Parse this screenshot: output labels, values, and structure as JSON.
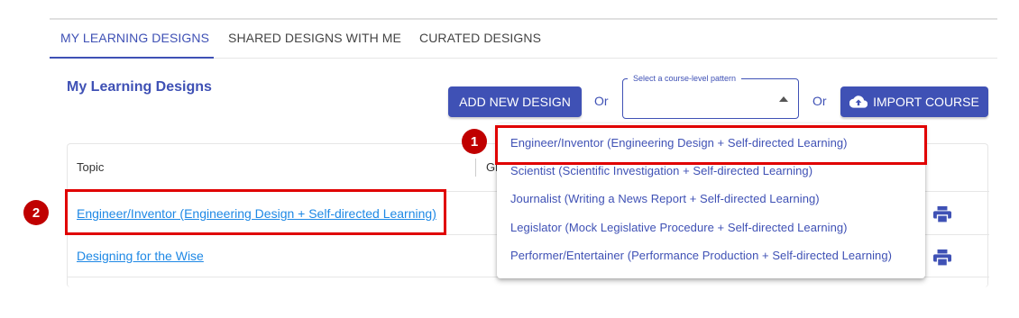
{
  "tabs": [
    {
      "label": "MY LEARNING DESIGNS",
      "active": true
    },
    {
      "label": "SHARED DESIGNS WITH ME",
      "active": false
    },
    {
      "label": "CURATED DESIGNS",
      "active": false
    }
  ],
  "page": {
    "heading": "My Learning Designs"
  },
  "toolbar": {
    "add_label": "ADD NEW DESIGN",
    "or_label": "Or",
    "select_legend": "Select a course-level pattern",
    "select_value": "",
    "import_label": "IMPORT COURSE",
    "import_icon": "cloud-upload-icon"
  },
  "table": {
    "columns": [
      "Topic",
      "Gr"
    ],
    "rows": [
      {
        "topic": "Engineer/Inventor (Engineering Design + Self-directed Learning)",
        "action_icon": "print-icon"
      },
      {
        "topic": "Designing for the Wise",
        "action_icon": "print-icon"
      }
    ]
  },
  "dropdown": {
    "options": [
      "Engineer/Inventor (Engineering Design + Self-directed Learning)",
      "Scientist (Scientific Investigation + Self-directed Learning)",
      "Journalist (Writing a News Report + Self-directed Learning)",
      "Legislator (Mock Legislative Procedure + Self-directed Learning)",
      "Performer/Entertainer (Performance Production + Self-directed Learning)"
    ]
  },
  "annotations": {
    "badge_1": "1",
    "badge_2": "2",
    "highlight_color": "#e00000"
  },
  "colors": {
    "primary": "#3f51b5",
    "link": "#1e88e5"
  }
}
